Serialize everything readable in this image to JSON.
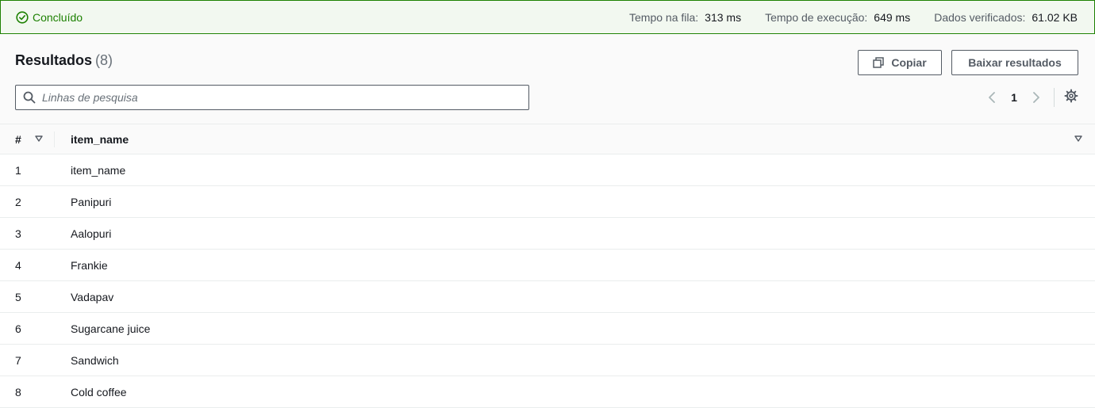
{
  "status": {
    "label": "Concluído",
    "color": "#1d8102",
    "icon": "check-circle-icon",
    "metrics": [
      {
        "label": "Tempo na fila:",
        "value": "313 ms"
      },
      {
        "label": "Tempo de execução:",
        "value": "649 ms"
      },
      {
        "label": "Dados verificados:",
        "value": "61.02 KB"
      }
    ]
  },
  "results": {
    "title": "Resultados",
    "count": "(8)",
    "copy_label": "Copiar",
    "download_label": "Baixar resultados",
    "search_placeholder": "Linhas de pesquisa",
    "page": "1"
  },
  "table": {
    "columns": [
      "#",
      "item_name"
    ],
    "rows": [
      {
        "num": "1",
        "item_name": "item_name"
      },
      {
        "num": "2",
        "item_name": "Panipuri"
      },
      {
        "num": "3",
        "item_name": "Aalopuri"
      },
      {
        "num": "4",
        "item_name": "Frankie"
      },
      {
        "num": "5",
        "item_name": "Vadapav"
      },
      {
        "num": "6",
        "item_name": "Sugarcane juice"
      },
      {
        "num": "7",
        "item_name": "Sandwich"
      },
      {
        "num": "8",
        "item_name": "Cold coffee"
      }
    ]
  }
}
